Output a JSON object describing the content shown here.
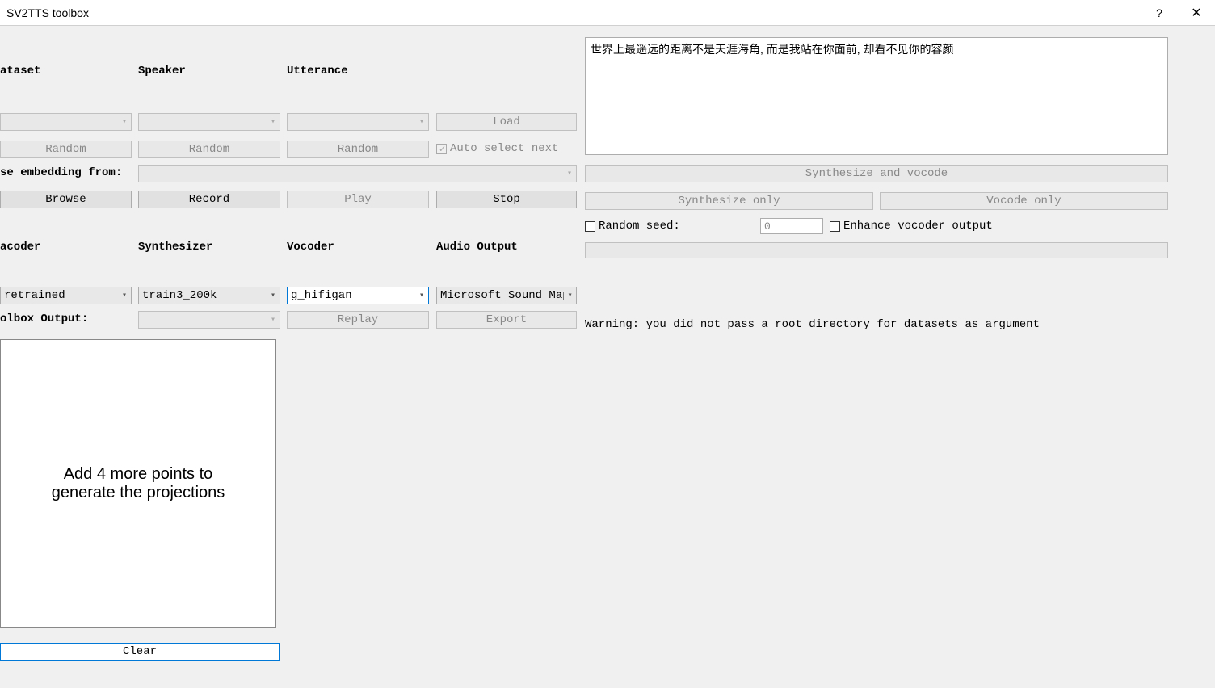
{
  "window": {
    "title": "SV2TTS toolbox"
  },
  "labels": {
    "dataset": "ataset",
    "speaker": "Speaker",
    "utterance": "Utterance",
    "use_embedding": "se embedding from:",
    "encoder": "acoder",
    "synthesizer": "Synthesizer",
    "vocoder": "Vocoder",
    "audio_output": "Audio Output",
    "toolbox_output": "olbox Output:",
    "random_seed": "Random seed:",
    "enhance": "Enhance vocoder output",
    "auto_select": "Auto select next"
  },
  "buttons": {
    "load": "Load",
    "random1": "Random",
    "random2": "Random",
    "random3": "Random",
    "browse": "Browse",
    "record": "Record",
    "play": "Play",
    "stop": "Stop",
    "replay": "Replay",
    "export": "Export",
    "clear": "Clear",
    "synth_vocode": "Synthesize and vocode",
    "synth_only": "Synthesize only",
    "vocode_only": "Vocode only"
  },
  "dropdowns": {
    "encoder_value": "retrained",
    "synthesizer_value": "train3_200k",
    "vocoder_value": "g_hifigan",
    "audio_output_value": "Microsoft Sound Mapp"
  },
  "inputs": {
    "text_content": "世界上最遥远的距离不是天涯海角, 而是我站在你面前, 却看不见你的容颜",
    "seed_value": "0"
  },
  "projection": {
    "message": "Add 4 more points to generate the projections"
  },
  "warning": {
    "text": "Warning: you did not pass a root directory for datasets as argument"
  }
}
